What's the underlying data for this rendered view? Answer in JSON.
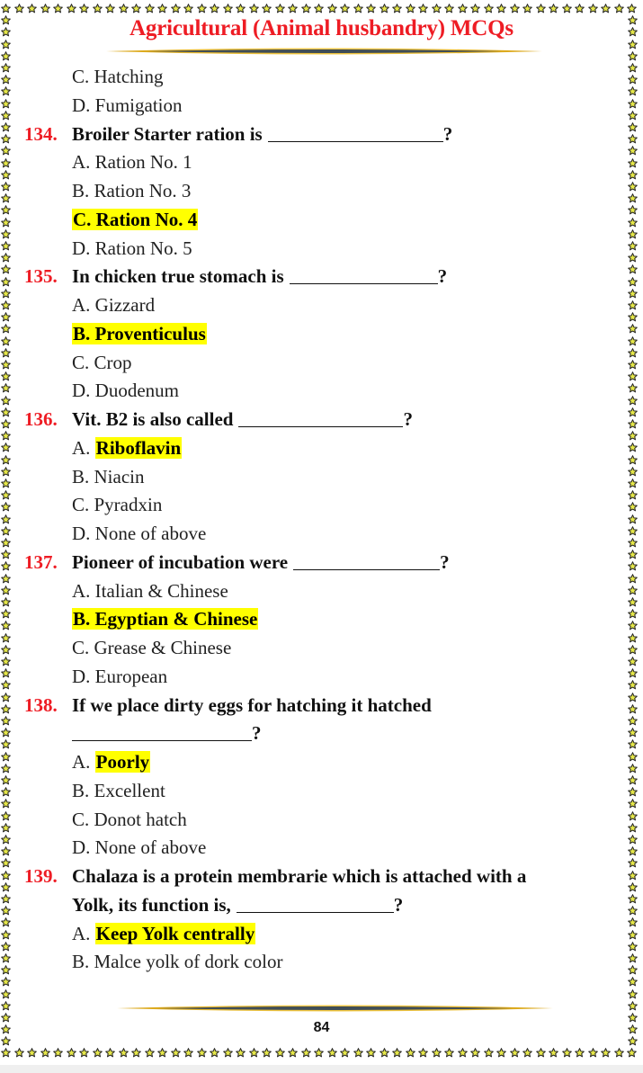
{
  "header": {
    "title": "Agricultural (Animal husbandry) MCQs"
  },
  "colors": {
    "accent_red": "#ee1c24",
    "highlight": "#ffff00",
    "star_fill": "#e6e84a"
  },
  "border_icon": "star-icon",
  "continued_options": [
    {
      "text": "C. Hatching"
    },
    {
      "text": "D. Fumigation"
    }
  ],
  "questions": [
    {
      "number": "134.",
      "lines": [
        "Broiler Starter ration is"
      ],
      "suffix": "?",
      "options": [
        {
          "letter": "",
          "text": "A. Ration No. 1",
          "correct": false
        },
        {
          "letter": "",
          "text": "B. Ration No. 3",
          "correct": false
        },
        {
          "letter": "",
          "text": "C. Ration No. 4",
          "correct": true
        },
        {
          "letter": "",
          "text": "D. Ration No. 5",
          "correct": false
        }
      ]
    },
    {
      "number": "135.",
      "lines": [
        "In chicken true stomach is"
      ],
      "suffix": "?",
      "options": [
        {
          "letter": "",
          "text": "A. Gizzard",
          "correct": false
        },
        {
          "letter": "",
          "text": "B. Proventiculus",
          "correct": true
        },
        {
          "letter": "",
          "text": "C. Crop",
          "correct": false
        },
        {
          "letter": "",
          "text": "D. Duodenum",
          "correct": false
        }
      ]
    },
    {
      "number": "136.",
      "lines": [
        "Vit. B2 is also called"
      ],
      "suffix": "?",
      "options": [
        {
          "letter": "A.",
          "text": "Riboflavin",
          "correct": true
        },
        {
          "letter": "",
          "text": "B. Niacin",
          "correct": false
        },
        {
          "letter": "",
          "text": "C. Pyradxin",
          "correct": false
        },
        {
          "letter": "",
          "text": "D. None of above",
          "correct": false
        }
      ]
    },
    {
      "number": "137.",
      "lines": [
        "Pioneer of incubation were"
      ],
      "suffix": "?",
      "options": [
        {
          "letter": "",
          "text": "A. Italian & Chinese",
          "correct": false
        },
        {
          "letter": "",
          "text": "B. Egyptian & Chinese",
          "correct": true
        },
        {
          "letter": "",
          "text": "C. Grease & Chinese",
          "correct": false
        },
        {
          "letter": "",
          "text": "D. European",
          "correct": false
        }
      ]
    },
    {
      "number": "138.",
      "lines": [
        "If we place dirty eggs for hatching it hatched",
        ""
      ],
      "suffix": "?",
      "options": [
        {
          "letter": "A.",
          "text": "Poorly",
          "correct": true
        },
        {
          "letter": "",
          "text": "B. Excellent",
          "correct": false
        },
        {
          "letter": "",
          "text": "C. Donot hatch",
          "correct": false
        },
        {
          "letter": "",
          "text": "D. None of above",
          "correct": false
        }
      ]
    },
    {
      "number": "139.",
      "lines": [
        "Chalaza is a protein membrarie which is attached with a",
        "Yolk, its function is,"
      ],
      "suffix": "?",
      "options": [
        {
          "letter": "A.",
          "text": "Keep Yolk centrally",
          "correct": true
        },
        {
          "letter": "",
          "text": "B. Malce yolk of dork color",
          "correct": false
        }
      ]
    }
  ],
  "footer": {
    "page_number": "84"
  }
}
